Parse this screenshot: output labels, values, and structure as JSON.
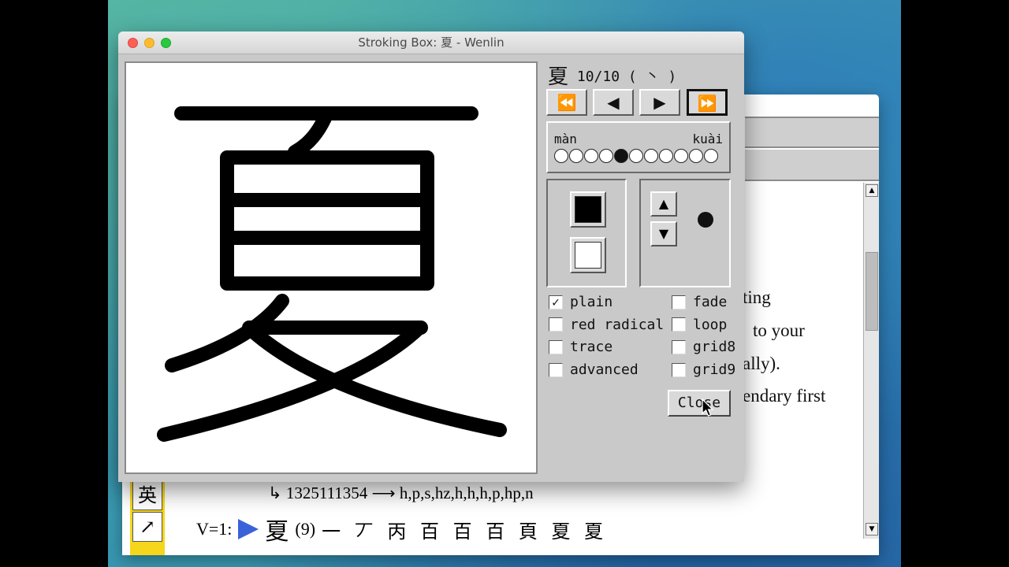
{
  "dialog": {
    "title": "Stroking Box: 夏 - Wenlin",
    "character": "夏",
    "stroke_progress": "10/10",
    "stroke_name": "( 丶 )",
    "nav": {
      "first": "⏪",
      "prev": "◀",
      "next": "▶",
      "last": "⏩"
    },
    "speed": {
      "slow_label": "màn",
      "fast_label": "kuài",
      "steps": 11,
      "selected_index": 4
    },
    "options_left": [
      {
        "label": "plain",
        "checked": true
      },
      {
        "label": "red radical",
        "checked": false
      },
      {
        "label": "trace",
        "checked": false
      },
      {
        "label": "advanced",
        "checked": false
      }
    ],
    "options_right": [
      {
        "label": "fade",
        "checked": false
      },
      {
        "label": "loop",
        "checked": false
      },
      {
        "label": "grid8",
        "checked": false
      },
      {
        "label": "grid9",
        "checked": false
      }
    ],
    "close_label": "Close"
  },
  "background_window": {
    "text_lines": [
      "ting",
      "to your",
      "ally).",
      "endary first"
    ],
    "decomposition": "↳ 1325111354  ⟶  h,p,s,hz,h,h,h,p,hp,n",
    "v_label": "V=1:",
    "v_char": "夏",
    "v_count": "(9)",
    "stroke_sequence": "一 丆 丙 百 百 百 頁 夏 夏",
    "sidebar_buttons": [
      "英",
      "↗"
    ]
  },
  "colors": {
    "speed_selected": "#111111",
    "play_triangle": "#3a62d8",
    "sidebar": "#f5d61a"
  }
}
